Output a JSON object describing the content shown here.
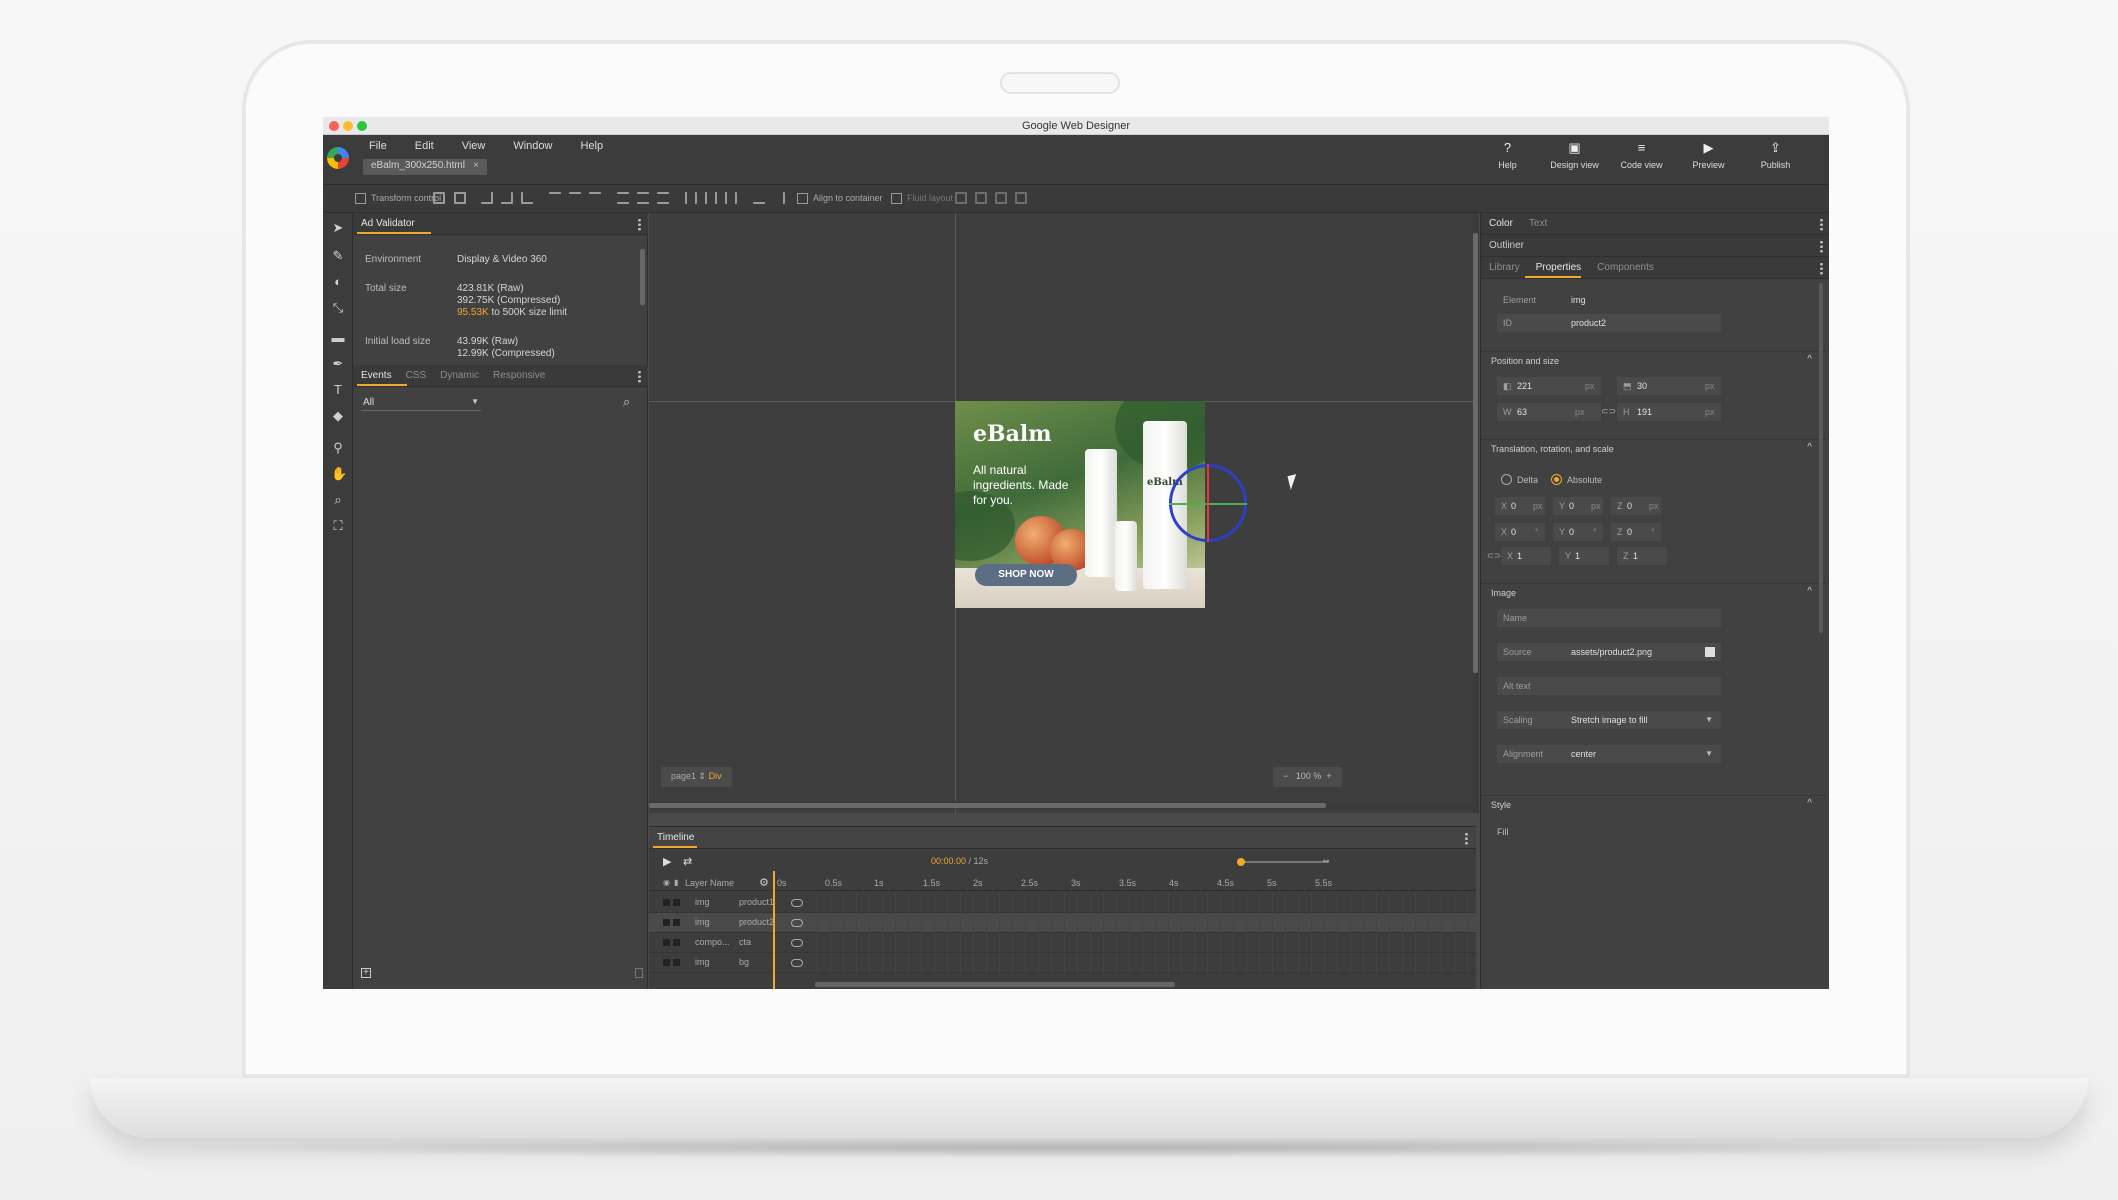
{
  "window": {
    "title": "Google Web Designer"
  },
  "menu": [
    "File",
    "Edit",
    "View",
    "Window",
    "Help"
  ],
  "file_tab": {
    "label": "eBalm_300x250.html",
    "close": "×"
  },
  "top_buttons": [
    {
      "label": "Help",
      "icon": "?"
    },
    {
      "label": "Design view",
      "icon": "▣"
    },
    {
      "label": "Code view",
      "icon": "≡"
    },
    {
      "label": "Preview",
      "icon": "▶"
    },
    {
      "label": "Publish",
      "icon": "⇪"
    }
  ],
  "toolbar": {
    "transform_control": "Transform control",
    "align_container": "Align to container",
    "fluid_layout": "Fluid layout"
  },
  "ad_validator": {
    "title": "Ad Validator",
    "environment_label": "Environment",
    "environment_value": "Display & Video 360",
    "total_size_label": "Total size",
    "total_raw": "423.81K (Raw)",
    "total_compressed": "392.75K (Compressed)",
    "total_limit_value": "95.53K",
    "total_limit_rest": " to 500K size limit",
    "initial_label": "Initial load size",
    "initial_raw": "43.99K (Raw)",
    "initial_compressed": "12.99K (Compressed)"
  },
  "events_panel": {
    "tabs": [
      "Events",
      "CSS",
      "Dynamic",
      "Responsive"
    ],
    "filter": "All"
  },
  "stage": {
    "page_selector": "page1 ⇕",
    "page_element": "Div",
    "zoom": "100 %",
    "zoom_minus": "−",
    "zoom_plus": "+"
  },
  "ad": {
    "brand": "eBalm",
    "tagline": "All natural ingredients. Made for you.",
    "cta": "SHOP NOW",
    "tube_label": "eBalm"
  },
  "timeline": {
    "title": "Timeline",
    "time_current": "00:00.00",
    "time_total": " / 12s",
    "header": "Layer Name",
    "ticks": [
      "0s",
      "0.5s",
      "1s",
      "1.5s",
      "2s",
      "2.5s",
      "3s",
      "3.5s",
      "4s",
      "4.5s",
      "5s",
      "5.5s"
    ],
    "layers": [
      {
        "type": "img",
        "name": "product1"
      },
      {
        "type": "img",
        "name": "product2"
      },
      {
        "type": "compo...",
        "name": "cta"
      },
      {
        "type": "img",
        "name": "bg"
      }
    ]
  },
  "right_panel": {
    "top_tabs": [
      "Color",
      "Text"
    ],
    "outliner": "Outliner",
    "tabs": [
      "Library",
      "Properties",
      "Components"
    ],
    "element_label": "Element",
    "element_value": "img",
    "id_label": "ID",
    "id_value": "product2",
    "position_section": "Position and size",
    "left_value": "221",
    "top_value": "30",
    "w_label": "W",
    "w_value": "63",
    "h_label": "H",
    "h_value": "191",
    "unit": "px",
    "trs_section": "Translation, rotation, and scale",
    "delta": "Delta",
    "absolute": "Absolute",
    "translate": [
      {
        "axis": "X",
        "value": "0"
      },
      {
        "axis": "Y",
        "value": "0"
      },
      {
        "axis": "Z",
        "value": "0"
      }
    ],
    "rotate": [
      {
        "axis": "X",
        "value": "0"
      },
      {
        "axis": "Y",
        "value": "0"
      },
      {
        "axis": "Z",
        "value": "0"
      }
    ],
    "scale": [
      {
        "axis": "X",
        "value": "1"
      },
      {
        "axis": "Y",
        "value": "1"
      },
      {
        "axis": "Z",
        "value": "1"
      }
    ],
    "degree": "°",
    "image_section": "Image",
    "name_label": "Name",
    "source_label": "Source",
    "source_value": "assets/product2.png",
    "alt_label": "Alt text",
    "scaling_label": "Scaling",
    "scaling_value": "Stretch image to fill",
    "alignment_label": "Alignment",
    "alignment_value": "center",
    "style_section": "Style",
    "fill_label": "Fill",
    "collapse": "^"
  },
  "colors": {
    "accent": "#f0a830",
    "panel": "#414141",
    "canvas": "#3e3e3e"
  }
}
